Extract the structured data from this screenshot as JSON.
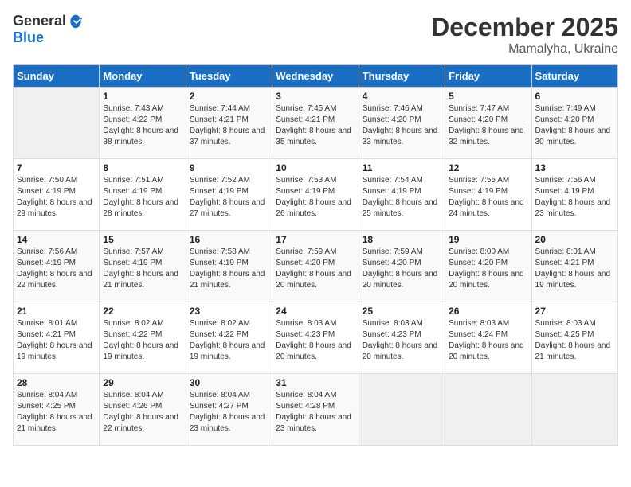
{
  "header": {
    "logo_general": "General",
    "logo_blue": "Blue",
    "month": "December 2025",
    "location": "Mamalyha, Ukraine"
  },
  "weekdays": [
    "Sunday",
    "Monday",
    "Tuesday",
    "Wednesday",
    "Thursday",
    "Friday",
    "Saturday"
  ],
  "weeks": [
    [
      {
        "day": "",
        "empty": true
      },
      {
        "day": "1",
        "sunrise": "Sunrise: 7:43 AM",
        "sunset": "Sunset: 4:22 PM",
        "daylight": "Daylight: 8 hours and 38 minutes."
      },
      {
        "day": "2",
        "sunrise": "Sunrise: 7:44 AM",
        "sunset": "Sunset: 4:21 PM",
        "daylight": "Daylight: 8 hours and 37 minutes."
      },
      {
        "day": "3",
        "sunrise": "Sunrise: 7:45 AM",
        "sunset": "Sunset: 4:21 PM",
        "daylight": "Daylight: 8 hours and 35 minutes."
      },
      {
        "day": "4",
        "sunrise": "Sunrise: 7:46 AM",
        "sunset": "Sunset: 4:20 PM",
        "daylight": "Daylight: 8 hours and 33 minutes."
      },
      {
        "day": "5",
        "sunrise": "Sunrise: 7:47 AM",
        "sunset": "Sunset: 4:20 PM",
        "daylight": "Daylight: 8 hours and 32 minutes."
      },
      {
        "day": "6",
        "sunrise": "Sunrise: 7:49 AM",
        "sunset": "Sunset: 4:20 PM",
        "daylight": "Daylight: 8 hours and 30 minutes."
      }
    ],
    [
      {
        "day": "7",
        "sunrise": "Sunrise: 7:50 AM",
        "sunset": "Sunset: 4:19 PM",
        "daylight": "Daylight: 8 hours and 29 minutes."
      },
      {
        "day": "8",
        "sunrise": "Sunrise: 7:51 AM",
        "sunset": "Sunset: 4:19 PM",
        "daylight": "Daylight: 8 hours and 28 minutes."
      },
      {
        "day": "9",
        "sunrise": "Sunrise: 7:52 AM",
        "sunset": "Sunset: 4:19 PM",
        "daylight": "Daylight: 8 hours and 27 minutes."
      },
      {
        "day": "10",
        "sunrise": "Sunrise: 7:53 AM",
        "sunset": "Sunset: 4:19 PM",
        "daylight": "Daylight: 8 hours and 26 minutes."
      },
      {
        "day": "11",
        "sunrise": "Sunrise: 7:54 AM",
        "sunset": "Sunset: 4:19 PM",
        "daylight": "Daylight: 8 hours and 25 minutes."
      },
      {
        "day": "12",
        "sunrise": "Sunrise: 7:55 AM",
        "sunset": "Sunset: 4:19 PM",
        "daylight": "Daylight: 8 hours and 24 minutes."
      },
      {
        "day": "13",
        "sunrise": "Sunrise: 7:56 AM",
        "sunset": "Sunset: 4:19 PM",
        "daylight": "Daylight: 8 hours and 23 minutes."
      }
    ],
    [
      {
        "day": "14",
        "sunrise": "Sunrise: 7:56 AM",
        "sunset": "Sunset: 4:19 PM",
        "daylight": "Daylight: 8 hours and 22 minutes."
      },
      {
        "day": "15",
        "sunrise": "Sunrise: 7:57 AM",
        "sunset": "Sunset: 4:19 PM",
        "daylight": "Daylight: 8 hours and 21 minutes."
      },
      {
        "day": "16",
        "sunrise": "Sunrise: 7:58 AM",
        "sunset": "Sunset: 4:19 PM",
        "daylight": "Daylight: 8 hours and 21 minutes."
      },
      {
        "day": "17",
        "sunrise": "Sunrise: 7:59 AM",
        "sunset": "Sunset: 4:20 PM",
        "daylight": "Daylight: 8 hours and 20 minutes."
      },
      {
        "day": "18",
        "sunrise": "Sunrise: 7:59 AM",
        "sunset": "Sunset: 4:20 PM",
        "daylight": "Daylight: 8 hours and 20 minutes."
      },
      {
        "day": "19",
        "sunrise": "Sunrise: 8:00 AM",
        "sunset": "Sunset: 4:20 PM",
        "daylight": "Daylight: 8 hours and 20 minutes."
      },
      {
        "day": "20",
        "sunrise": "Sunrise: 8:01 AM",
        "sunset": "Sunset: 4:21 PM",
        "daylight": "Daylight: 8 hours and 19 minutes."
      }
    ],
    [
      {
        "day": "21",
        "sunrise": "Sunrise: 8:01 AM",
        "sunset": "Sunset: 4:21 PM",
        "daylight": "Daylight: 8 hours and 19 minutes."
      },
      {
        "day": "22",
        "sunrise": "Sunrise: 8:02 AM",
        "sunset": "Sunset: 4:22 PM",
        "daylight": "Daylight: 8 hours and 19 minutes."
      },
      {
        "day": "23",
        "sunrise": "Sunrise: 8:02 AM",
        "sunset": "Sunset: 4:22 PM",
        "daylight": "Daylight: 8 hours and 19 minutes."
      },
      {
        "day": "24",
        "sunrise": "Sunrise: 8:03 AM",
        "sunset": "Sunset: 4:23 PM",
        "daylight": "Daylight: 8 hours and 20 minutes."
      },
      {
        "day": "25",
        "sunrise": "Sunrise: 8:03 AM",
        "sunset": "Sunset: 4:23 PM",
        "daylight": "Daylight: 8 hours and 20 minutes."
      },
      {
        "day": "26",
        "sunrise": "Sunrise: 8:03 AM",
        "sunset": "Sunset: 4:24 PM",
        "daylight": "Daylight: 8 hours and 20 minutes."
      },
      {
        "day": "27",
        "sunrise": "Sunrise: 8:03 AM",
        "sunset": "Sunset: 4:25 PM",
        "daylight": "Daylight: 8 hours and 21 minutes."
      }
    ],
    [
      {
        "day": "28",
        "sunrise": "Sunrise: 8:04 AM",
        "sunset": "Sunset: 4:25 PM",
        "daylight": "Daylight: 8 hours and 21 minutes."
      },
      {
        "day": "29",
        "sunrise": "Sunrise: 8:04 AM",
        "sunset": "Sunset: 4:26 PM",
        "daylight": "Daylight: 8 hours and 22 minutes."
      },
      {
        "day": "30",
        "sunrise": "Sunrise: 8:04 AM",
        "sunset": "Sunset: 4:27 PM",
        "daylight": "Daylight: 8 hours and 23 minutes."
      },
      {
        "day": "31",
        "sunrise": "Sunrise: 8:04 AM",
        "sunset": "Sunset: 4:28 PM",
        "daylight": "Daylight: 8 hours and 23 minutes."
      },
      {
        "day": "",
        "empty": true
      },
      {
        "day": "",
        "empty": true
      },
      {
        "day": "",
        "empty": true
      }
    ]
  ]
}
